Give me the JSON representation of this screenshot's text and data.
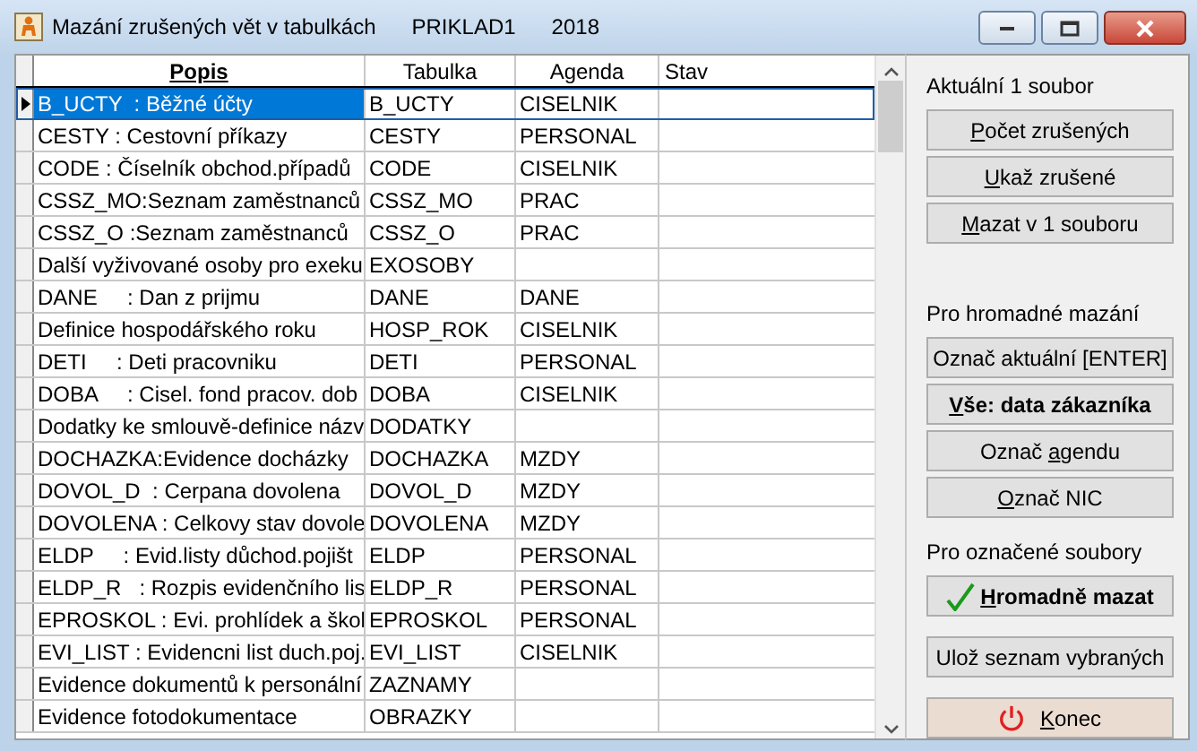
{
  "window": {
    "title": "Mazání zrušených vět v tabulkách",
    "subtitle": "PRIKLAD1",
    "year": "2018"
  },
  "table": {
    "columns": [
      {
        "label": "Popis",
        "bold": true
      },
      {
        "label": "Tabulka",
        "bold": false
      },
      {
        "label": "Agenda",
        "bold": false
      },
      {
        "label": "Stav",
        "bold": false
      }
    ],
    "rows": [
      {
        "popis": "B_UCTY  : Běžné účty",
        "tabulka": "B_UCTY",
        "agenda": "CISELNIK",
        "selected": true
      },
      {
        "popis": "CESTY : Cestovní příkazy",
        "tabulka": "CESTY",
        "agenda": "PERSONAL",
        "selected": false
      },
      {
        "popis": "CODE : Číselník obchod.případů",
        "tabulka": "CODE",
        "agenda": "CISELNIK",
        "selected": false
      },
      {
        "popis": "CSSZ_MO:Seznam zaměstnanců",
        "tabulka": "CSSZ_MO",
        "agenda": "PRAC",
        "selected": false
      },
      {
        "popis": "CSSZ_O :Seznam zaměstnanců",
        "tabulka": "CSSZ_O",
        "agenda": "PRAC",
        "selected": false
      },
      {
        "popis": "Další vyživované osoby pro exeku",
        "tabulka": "EXOSOBY",
        "selected": false
      },
      {
        "popis": "DANE     : Dan z prijmu",
        "tabulka": "DANE",
        "agenda": "DANE",
        "selected": false
      },
      {
        "popis": "Definice hospodářského roku",
        "tabulka": "HOSP_ROK",
        "agenda": "CISELNIK",
        "selected": false
      },
      {
        "popis": "DETI     : Deti pracovniku",
        "tabulka": "DETI",
        "agenda": "PERSONAL",
        "selected": false
      },
      {
        "popis": "DOBA     : Cisel. fond pracov. dob",
        "tabulka": "DOBA",
        "agenda": "CISELNIK",
        "selected": false
      },
      {
        "popis": "Dodatky ke smlouvě-definice názv",
        "tabulka": "DODATKY",
        "selected": false
      },
      {
        "popis": "DOCHAZKA:Evidence docházky",
        "tabulka": "DOCHAZKA",
        "agenda": "MZDY",
        "selected": false
      },
      {
        "popis": "DOVOL_D  : Cerpana dovolena",
        "tabulka": "DOVOL_D",
        "agenda": "MZDY",
        "selected": false
      },
      {
        "popis": "DOVOLENA : Celkovy stav dovole",
        "tabulka": "DOVOLENA",
        "agenda": "MZDY",
        "selected": false
      },
      {
        "popis": "ELDP     : Evid.listy důchod.pojišt",
        "tabulka": "ELDP",
        "agenda": "PERSONAL",
        "selected": false
      },
      {
        "popis": "ELDP_R   : Rozpis evidenčního lis",
        "tabulka": "ELDP_R",
        "agenda": "PERSONAL",
        "selected": false
      },
      {
        "popis": "EPROSKOL : Evi. prohlídek a škol",
        "tabulka": "EPROSKOL",
        "agenda": "PERSONAL",
        "selected": false
      },
      {
        "popis": "EVI_LIST : Evidencni list duch.poj.",
        "tabulka": "EVI_LIST",
        "agenda": "CISELNIK",
        "selected": false
      },
      {
        "popis": "Evidence dokumentů k personální",
        "tabulka": "ZAZNAMY",
        "selected": false
      },
      {
        "popis": "Evidence fotodokumentace",
        "tabulka": "OBRAZKY",
        "selected": false
      }
    ]
  },
  "panel": [
    {
      "title": "Aktuální 1 soubor",
      "buttons": [
        {
          "kind": "plain",
          "key": "P",
          "post": "očet zrušených"
        },
        {
          "kind": "plain",
          "key": "U",
          "post": "kaž zrušené"
        },
        {
          "kind": "plain",
          "key": "M",
          "post": "azat v 1 souboru"
        }
      ]
    },
    {
      "title": "Pro hromadné mazání",
      "buttons": [
        {
          "kind": "plain",
          "label": "Označ aktuální [ENTER]"
        },
        {
          "kind": "bold",
          "key": "V",
          "post": "še: data zákazníka"
        },
        {
          "kind": "plain",
          "pre": "Označ ",
          "key": "a",
          "post": "gendu"
        },
        {
          "kind": "plain",
          "key": "O",
          "post": "znač NIC"
        }
      ]
    },
    {
      "title": "Pro označené soubory",
      "buttons": [
        {
          "kind": "confirm",
          "key": "H",
          "post": "romadně mazat"
        },
        {
          "kind": "plain",
          "label": "Ulož seznam vybraných"
        },
        {
          "kind": "exit",
          "key": "K",
          "post": "onec"
        }
      ]
    }
  ]
}
